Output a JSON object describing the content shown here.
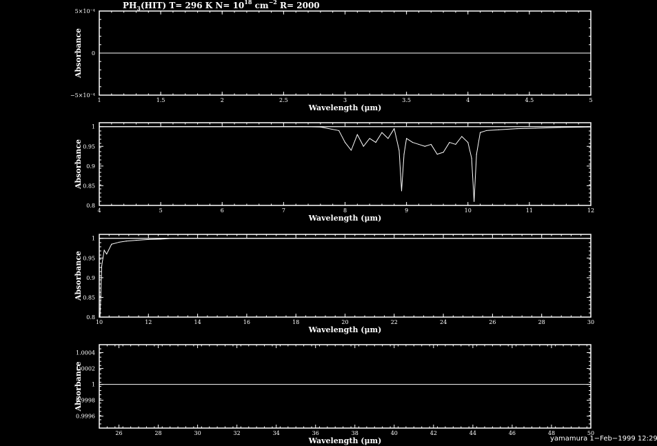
{
  "title_parts": [
    "PH",
    "3",
    "(HIT) T= 296 K N= 10",
    "18",
    " cm",
    "−2",
    " R= 2000"
  ],
  "footer": "yamamura  1−Feb−1999 12:29",
  "chart_data": [
    {
      "type": "line",
      "xlabel": "Wavelength (μm)",
      "ylabel": "Absorbance",
      "xlim": [
        1,
        5
      ],
      "ylim": [
        -0.0005,
        0.0005
      ],
      "xticks": [
        "1",
        "1.5",
        "2",
        "2.5",
        "3",
        "3.5",
        "4",
        "4.5",
        "5"
      ],
      "yticks": [
        "−5×10⁻⁴",
        "0",
        "5×10⁻⁴"
      ],
      "series": [
        {
          "x": [
            1,
            5
          ],
          "y": [
            0,
            0
          ]
        }
      ]
    },
    {
      "type": "line",
      "xlabel": "Wavelength (μm)",
      "ylabel": "Absorbance",
      "xlim": [
        4,
        12
      ],
      "ylim": [
        0.8,
        1.01
      ],
      "xticks": [
        "4",
        "5",
        "6",
        "7",
        "8",
        "9",
        "10",
        "11",
        "12"
      ],
      "yticks": [
        "0.8",
        "0.85",
        "0.9",
        "0.95",
        "1"
      ],
      "baseline": 1.0,
      "series": [
        {
          "x": [
            4,
            7.3,
            7.6,
            7.9,
            8.0,
            8.1,
            8.2,
            8.3,
            8.4,
            8.5,
            8.6,
            8.7,
            8.8,
            8.88,
            8.92,
            8.96,
            9.0,
            9.1,
            9.2,
            9.3,
            9.4,
            9.5,
            9.6,
            9.7,
            9.8,
            9.9,
            10.0,
            10.06,
            10.1,
            10.14,
            10.2,
            10.3,
            10.5,
            10.8,
            11.1,
            11.5,
            12
          ],
          "y": [
            1.0,
            1.0,
            0.999,
            0.99,
            0.96,
            0.94,
            0.98,
            0.95,
            0.97,
            0.96,
            0.985,
            0.97,
            0.995,
            0.94,
            0.837,
            0.93,
            0.97,
            0.96,
            0.955,
            0.95,
            0.955,
            0.93,
            0.935,
            0.96,
            0.955,
            0.975,
            0.96,
            0.92,
            0.81,
            0.93,
            0.985,
            0.99,
            0.992,
            0.995,
            0.996,
            0.998,
            0.999
          ]
        }
      ]
    },
    {
      "type": "line",
      "xlabel": "Wavelength (μm)",
      "ylabel": "Absorbance",
      "xlim": [
        10,
        30
      ],
      "ylim": [
        0.8,
        1.01
      ],
      "xticks": [
        "10",
        "12",
        "14",
        "16",
        "18",
        "20",
        "22",
        "24",
        "26",
        "28",
        "30"
      ],
      "yticks": [
        "0.8",
        "0.85",
        "0.9",
        "0.95",
        "1"
      ],
      "baseline": 1.0,
      "series": [
        {
          "x": [
            10,
            10.03,
            10.06,
            10.1,
            10.2,
            10.3,
            10.5,
            10.8,
            11.1,
            11.5,
            12,
            12.5,
            13,
            30
          ],
          "y": [
            0.81,
            0.8,
            0.85,
            0.93,
            0.97,
            0.96,
            0.985,
            0.99,
            0.993,
            0.995,
            0.997,
            0.998,
            1.0,
            1.0
          ]
        }
      ]
    },
    {
      "type": "line",
      "xlabel": "Wavelength (μm)",
      "ylabel": "Absorbance",
      "xlim": [
        25,
        50
      ],
      "ylim": [
        0.99945,
        1.0005
      ],
      "xticks": [
        "26",
        "28",
        "30",
        "32",
        "34",
        "36",
        "38",
        "40",
        "42",
        "44",
        "46",
        "48",
        "50"
      ],
      "yticks": [
        "0.9996",
        "0.9998",
        "1",
        "1.0002",
        "1.0004"
      ],
      "series": [
        {
          "x": [
            25,
            50
          ],
          "y": [
            1.0,
            1.0
          ]
        }
      ]
    }
  ]
}
